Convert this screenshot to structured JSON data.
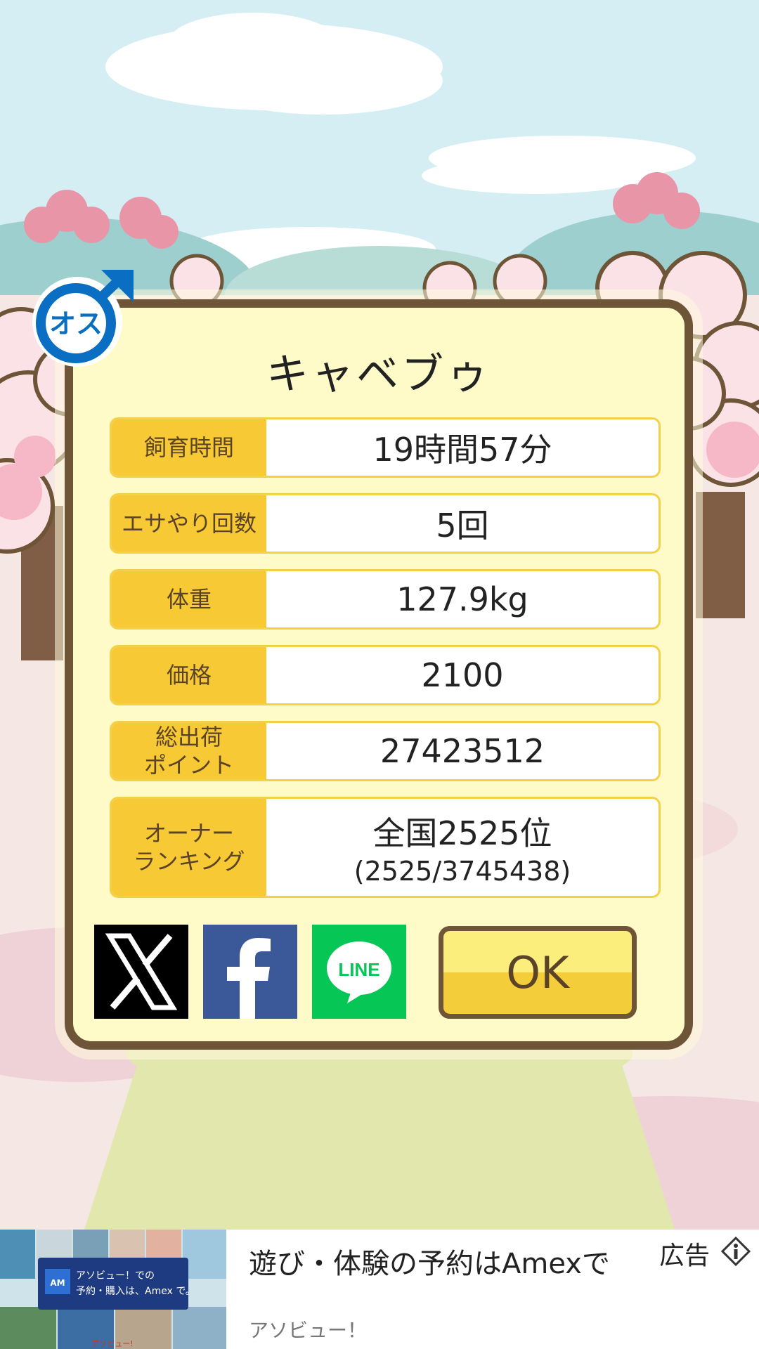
{
  "pet": {
    "name": "キャベブゥ",
    "gender_badge": "オス"
  },
  "stats": [
    {
      "label": "飼育時間",
      "value": "19時間57分"
    },
    {
      "label": "エサやり回数",
      "value": "5回"
    },
    {
      "label": "体重",
      "value": "127.9kg"
    },
    {
      "label": "価格",
      "value": "2100"
    },
    {
      "label": "総出荷\nポイント",
      "value": "27423512"
    },
    {
      "label": "オーナー\nランキング",
      "value": "全国2525位",
      "sub": "(2525/3745438)"
    }
  ],
  "buttons": {
    "ok": "OK",
    "x_icon": "x-logo-icon",
    "facebook_icon": "facebook-logo-icon",
    "line_icon": "line-logo-icon",
    "line_text": "LINE"
  },
  "ad": {
    "title": "遊び・体験の予約はAmexで",
    "advertiser": "アソビュー！",
    "label": "広告",
    "banner_line1": "アソビュー！での",
    "banner_line2": "予約・購入は、Amex で。",
    "banner_brand": "アソビュー!"
  },
  "colors": {
    "label_bg": "#f7c935",
    "card_bg": "#fffbc8",
    "card_border": "#6e5538",
    "badge_blue": "#0a6fc2",
    "facebook": "#3b5998",
    "line": "#06c755"
  }
}
